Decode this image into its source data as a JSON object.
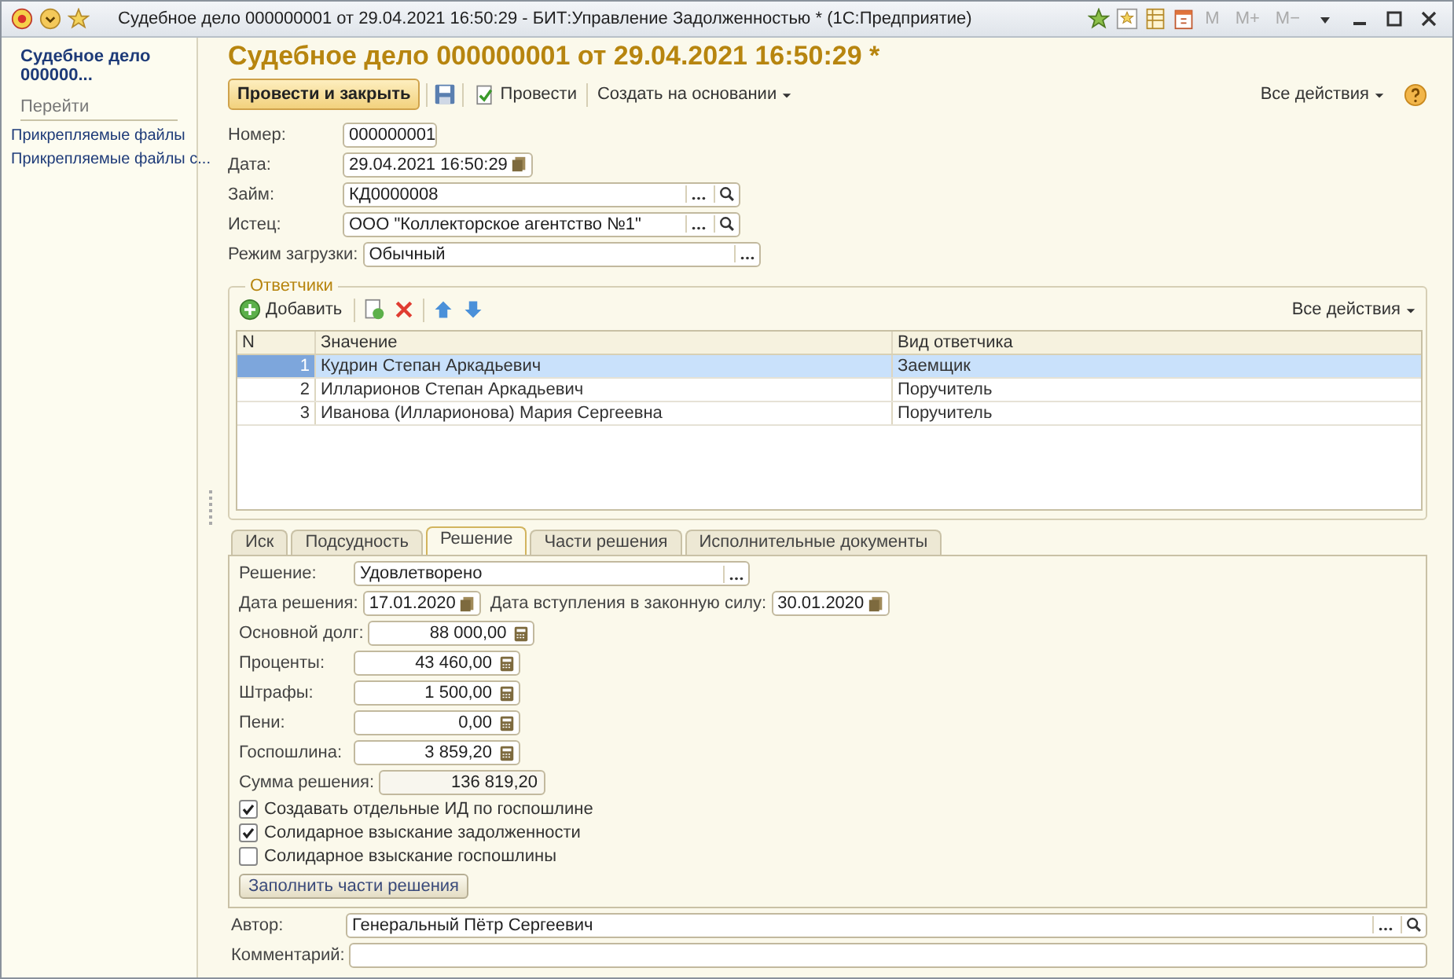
{
  "window": {
    "title": "Судебное дело 000000001 от 29.04.2021 16:50:29 - БИТ:Управление Задолженностью * (1С:Предприятие)",
    "memory_buttons": [
      "M",
      "M+",
      "M−"
    ]
  },
  "sidebar": {
    "title": "Судебное дело 000000...",
    "section": "Перейти",
    "items": [
      "Прикрепляемые файлы",
      "Прикрепляемые файлы с..."
    ]
  },
  "form": {
    "heading": "Судебное дело 000000001 от 29.04.2021 16:50:29 *",
    "toolbar": {
      "post_and_close": "Провести и закрыть",
      "post": "Провести",
      "create_based": "Создать на основании",
      "all_actions": "Все действия"
    }
  },
  "fields": [
    {
      "label": "Номер:",
      "value": "000000001",
      "kind": "number"
    },
    {
      "label": "Дата:",
      "value": "29.04.2021 16:50:29",
      "kind": "date"
    },
    {
      "label": "Займ:",
      "value": "КД0000008",
      "kind": "lookup"
    },
    {
      "label": "Истец:",
      "value": "ООО \"Коллекторское агентство №1\"",
      "kind": "lookup"
    },
    {
      "label": "Режим загрузки:",
      "value": "Обычный",
      "kind": "choice"
    }
  ],
  "respondents": {
    "title": "Ответчики",
    "add": "Добавить",
    "all_actions": "Все действия",
    "columns": [
      "N",
      "Значение",
      "Вид ответчика"
    ],
    "rows": [
      {
        "n": "1",
        "name": "Кудрин Степан Аркадьевич",
        "type": "Заемщик",
        "selected": true
      },
      {
        "n": "2",
        "name": "Илларионов Степан Аркадьевич",
        "type": "Поручитель",
        "selected": false
      },
      {
        "n": "3",
        "name": "Иванова (Илларионова) Мария Сергеевна",
        "type": "Поручитель",
        "selected": false
      }
    ]
  },
  "tabs": [
    {
      "label": "Иск",
      "selected": false
    },
    {
      "label": "Подсудность",
      "selected": false
    },
    {
      "label": "Решение",
      "selected": true
    },
    {
      "label": "Части решения",
      "selected": false
    },
    {
      "label": "Исполнительные документы",
      "selected": false
    }
  ],
  "decision": {
    "result": {
      "label": "Решение:",
      "value": "Удовлетворено"
    },
    "decision_date": {
      "label": "Дата решения:",
      "value": "17.01.2020"
    },
    "effective_date": {
      "label": "Дата вступления в законную силу:",
      "value": "30.01.2020"
    },
    "amounts": [
      {
        "label": "Основной долг:",
        "value": "88 000,00",
        "calculator": true
      },
      {
        "label": "Проценты:",
        "value": "43 460,00",
        "calculator": true
      },
      {
        "label": "Штрафы:",
        "value": "1 500,00",
        "calculator": true
      },
      {
        "label": "Пени:",
        "value": "0,00",
        "calculator": true
      },
      {
        "label": "Госпошлина:",
        "value": "3 859,20",
        "calculator": true
      },
      {
        "label": "Сумма решения:",
        "value": "136 819,20",
        "calculator": false
      }
    ],
    "checkboxes": [
      {
        "label": "Создавать отдельные ИД по госпошлине",
        "checked": true
      },
      {
        "label": "Солидарное взыскание задолженности",
        "checked": true
      },
      {
        "label": "Солидарное взыскание госпошлины",
        "checked": false
      }
    ],
    "fill_button": "Заполнить части решения"
  },
  "author": {
    "label": "Автор:",
    "value": "Генеральный Пётр Сергеевич"
  },
  "comment": {
    "label": "Комментарий:"
  }
}
